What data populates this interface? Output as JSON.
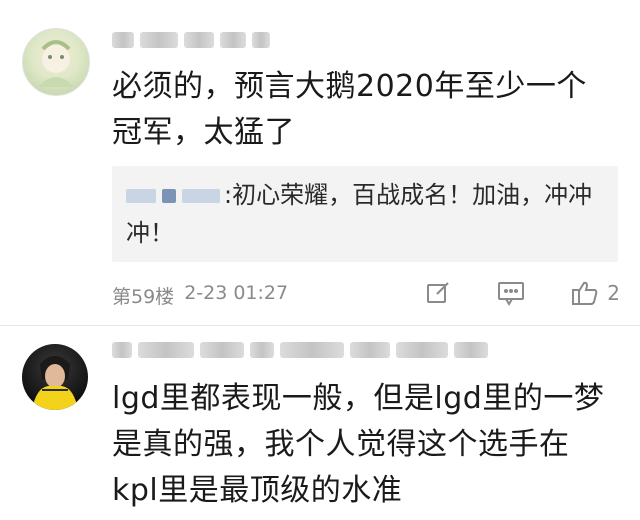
{
  "comments": [
    {
      "content": "必须的，预言大鹅2020年至少一个冠军，太猛了",
      "reply": {
        "text": ":初心荣耀，百战成名！加油，冲冲冲！"
      },
      "floor": "第59楼",
      "time": "2-23 01:27",
      "likes": "2"
    },
    {
      "content": "lgd里都表现一般，但是lgd里的一梦是真的强，我个人觉得这个选手在kpl里是最顶级的水准"
    }
  ],
  "icons": {
    "edit": "edit-icon",
    "reply": "comment-icon",
    "like": "thumbs-up-icon"
  },
  "colors": {
    "meta": "#8a8a8a",
    "reply_bg": "#f3f3f3",
    "divider": "#e8e8e8"
  }
}
